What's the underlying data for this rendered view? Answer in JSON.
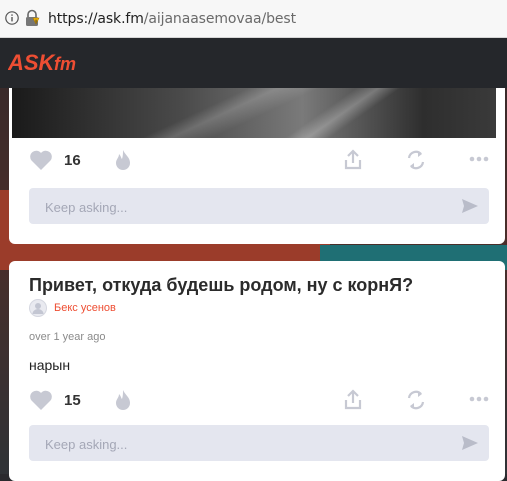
{
  "browser": {
    "url_host": "https://ask.fm",
    "url_path": "/aijanaasemovaa/best"
  },
  "header": {
    "logo_text": "ASKfm"
  },
  "colors": {
    "accent": "#ee4e33",
    "header_bg": "#25272b",
    "input_bg": "#e4e6ef",
    "icon": "#c7c9d3"
  },
  "posts": [
    {
      "likes": "16",
      "ask_placeholder": "Keep asking..."
    },
    {
      "question": "Привет, откуда будешь родом, ну с корнЯ?",
      "asker": "Бекс усенов",
      "timestamp": "over 1 year ago",
      "answer": "нарын",
      "likes": "15",
      "ask_placeholder": "Keep asking..."
    }
  ],
  "icons": [
    "info-icon",
    "lock-icon",
    "heart-icon",
    "fire-icon",
    "share-icon",
    "repeat-icon",
    "more-icon",
    "send-icon",
    "avatar-icon"
  ]
}
